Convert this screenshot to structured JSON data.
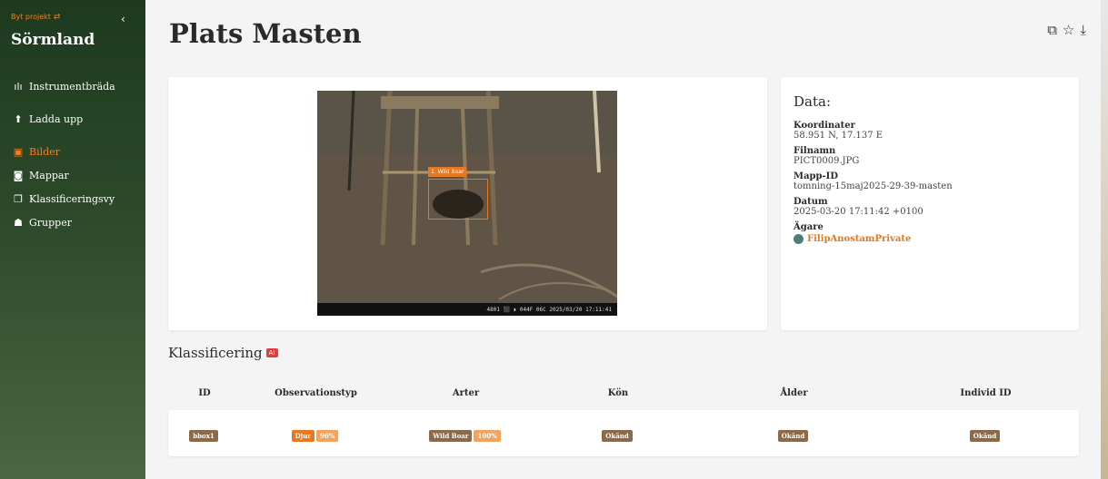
{
  "sidebar": {
    "switch_project": "Byt projekt",
    "project_name": "Sörmland",
    "collapse_icon": "chevron-left",
    "items": [
      {
        "label": "Instrumentbräda",
        "icon": "bar-chart-icon",
        "glyph": "ılı"
      },
      {
        "label": "Ladda upp",
        "icon": "upload-icon",
        "glyph": "⬆"
      },
      {
        "label": "Bilder",
        "icon": "images-icon",
        "glyph": "▣",
        "active": true
      },
      {
        "label": "Mappar",
        "icon": "camera-icon",
        "glyph": "◙"
      },
      {
        "label": "Klassificeringsvy",
        "icon": "copy-icon",
        "glyph": "❐"
      },
      {
        "label": "Grupper",
        "icon": "users-icon",
        "glyph": "👥"
      }
    ]
  },
  "header": {
    "title": "Plats Masten",
    "icons": [
      "copy-icon",
      "star-icon",
      "download-icon"
    ]
  },
  "image": {
    "bbox_label": "1. Wild Boar",
    "footer_text": "4801 ⬛ ◗ 044F 06C 2025/03/20 17:11:41"
  },
  "data": {
    "title": "Data:",
    "fields": [
      {
        "label": "Koordinater",
        "value": "58.951 N, 17.137 E"
      },
      {
        "label": "Filnamn",
        "value": "PICT0009.JPG"
      },
      {
        "label": "Mapp-ID",
        "value": "tomning-15maj2025-29-39-masten"
      },
      {
        "label": "Datum",
        "value": "2025-03-20 17:11:42 +0100"
      }
    ],
    "owner_label": "Ägare",
    "owner_name": "FilipAnostamPrivate"
  },
  "classification": {
    "title": "Klassificering",
    "badge": "AI",
    "headers": [
      "ID",
      "Observationstyp",
      "Arter",
      "Kön",
      "Ålder",
      "Individ ID"
    ],
    "row": {
      "id": "bbox1",
      "obs_type": "Djur",
      "obs_conf": "96%",
      "species": "Wild Boar",
      "species_conf": "100%",
      "sex": "Okänd",
      "age": "Okänd",
      "individual": "Okänd"
    }
  },
  "colors": {
    "accent": "#e8781e",
    "sidebar": "#1d3a1f",
    "chip_brown": "#8b6a4a",
    "ai_badge": "#e23d3d"
  }
}
